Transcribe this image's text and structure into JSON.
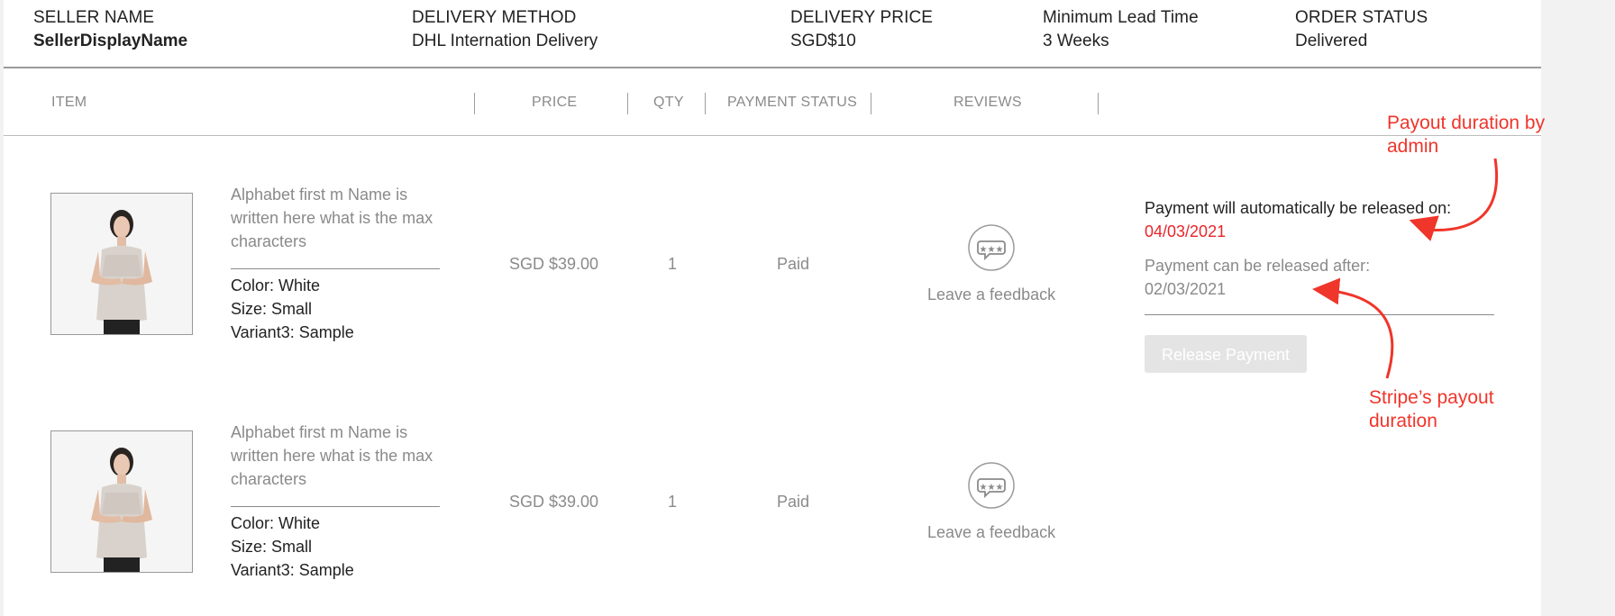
{
  "header": {
    "seller_label": "SELLER NAME",
    "seller_value": "SellerDisplayName",
    "delivery_method_label": "DELIVERY METHOD",
    "delivery_method_value": "DHL Internation Delivery",
    "delivery_price_label": "DELIVERY PRICE",
    "delivery_price_value": "SGD$10",
    "lead_time_label": "Minimum Lead Time",
    "lead_time_value": "3 Weeks",
    "order_status_label": "ORDER STATUS",
    "order_status_value": "Delivered"
  },
  "columns": [
    "ITEM",
    "PRICE",
    "QTY",
    "PAYMENT STATUS",
    "REVIEWS"
  ],
  "items": [
    {
      "name": "Alphabet first m Name is written here what is the max characters",
      "color": "Color: White",
      "size": "Size: Small",
      "variant": "Variant3: Sample",
      "price": "SGD $39.00",
      "qty": "1",
      "payment_status": "Paid",
      "feedback_label": "Leave a feedback"
    },
    {
      "name": "Alphabet first m Name is written here what is the max characters",
      "color": "Color: White",
      "size": "Size: Small",
      "variant": "Variant3: Sample",
      "price": "SGD $39.00",
      "qty": "1",
      "payment_status": "Paid",
      "feedback_label": "Leave a feedback"
    }
  ],
  "payment": {
    "auto_release_label": "Payment will automatically be released on:",
    "auto_release_date": "04/03/2021",
    "release_after_label": "Payment can be released after:",
    "release_after_date": "02/03/2021",
    "release_button": "Release Payment"
  },
  "annotations": {
    "admin_note": "Payout duration by admin",
    "stripe_note": "Stripe’s payout duration"
  },
  "icons": {
    "feedback": "speech-bubble-stars-icon",
    "product_image": "product-photo"
  },
  "colors": {
    "annotation_red": "#f0352a",
    "date_red": "#e8262a",
    "muted_text": "#8a8a8a",
    "button_disabled": "#e4e4e4"
  }
}
